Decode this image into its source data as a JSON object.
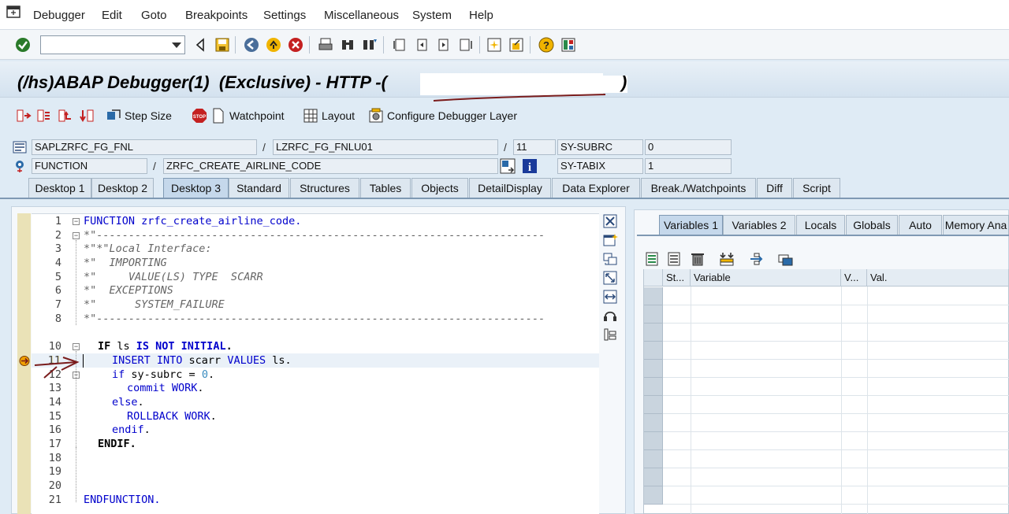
{
  "menubar": {
    "items": [
      "Debugger",
      "Edit",
      "Goto",
      "Breakpoints",
      "Settings",
      "Miscellaneous",
      "System",
      "Help"
    ]
  },
  "stdbar": {
    "command_value": "",
    "icons": [
      "enter-icon",
      "back-icon",
      "save-icon",
      "back-nav-icon",
      "exit-icon",
      "cancel-icon",
      "print-icon",
      "find-icon",
      "find-next-icon",
      "first-page-icon",
      "prev-page-icon",
      "next-page-icon",
      "last-page-icon",
      "new-session-icon",
      "shortcut-icon",
      "help-icon",
      "layout-icon"
    ]
  },
  "title": {
    "text": "(/hs)ABAP Debugger(1)  (Exclusive) - HTTP -(",
    "end": ")"
  },
  "app_toolbar": {
    "step_size": "Step Size",
    "watchpoint": "Watchpoint",
    "layout": "Layout",
    "configure": "Configure Debugger Layer"
  },
  "info": {
    "program": "SAPLZRFC_FG_FNL",
    "include": "LZRFC_FG_FNLU01",
    "line": "11",
    "sy_subrc_label": "SY-SUBRC",
    "sy_subrc_value": "0",
    "event_type": "FUNCTION",
    "event": "ZRFC_CREATE_AIRLINE_CODE",
    "sy_tabix_label": "SY-TABIX",
    "sy_tabix_value": "1",
    "sep": "/"
  },
  "tabs": [
    "Desktop 1",
    "Desktop 2",
    "Desktop 3",
    "Standard",
    "Structures",
    "Tables",
    "Objects",
    "DetailDisplay",
    "Data Explorer",
    "Break./Watchpoints",
    "Diff",
    "Script"
  ],
  "active_tab": "Desktop 3",
  "code": {
    "line_numbers": [
      "1",
      "2",
      "3",
      "4",
      "5",
      "6",
      "7",
      "8",
      "10",
      "11",
      "12",
      "13",
      "14",
      "15",
      "16",
      "17",
      "18",
      "19",
      "20",
      "21"
    ],
    "l1": "FUNCTION zrfc_create_airline_code.",
    "l2": "*\"----------------------------------------------------------------------",
    "l3": "*\"*\"Local Interface:",
    "l4": "*\"  IMPORTING",
    "l5": "*\"     VALUE(LS) TYPE  SCARR",
    "l6": "*\"  EXCEPTIONS",
    "l7": "*\"      SYSTEM_FAILURE",
    "l8": "*\"----------------------------------------------------------------------",
    "l10_kw1": "IF",
    "l10_id": " ls ",
    "l10_kw2": "IS NOT INITIAL",
    "l10_end": ".",
    "l11_kw1": "INSERT INTO",
    "l11_id": " scarr ",
    "l11_kw2": "VALUES",
    "l11_end": " ls.",
    "l12_kw": "if",
    "l12_id": " sy-subrc = ",
    "l12_num": "0",
    "l12_end": ".",
    "l13_kw": "commit WORK",
    "l13_end": ".",
    "l14_kw": "else",
    "l14_end": ".",
    "l15_kw": "ROLLBACK WORK",
    "l15_end": ".",
    "l16_kw": "endif",
    "l16_end": ".",
    "l17_kw": "ENDIF",
    "l17_end": ".",
    "l21_kw": "ENDFUNCTION",
    "l21_end": "."
  },
  "vars": {
    "tabs": [
      "Variables 1",
      "Variables 2",
      "Locals",
      "Globals",
      "Auto",
      "Memory Ana"
    ],
    "active": "Variables 1",
    "col_status": "St...",
    "col_variable": "Variable",
    "col_v": "V...",
    "col_val": "Val."
  },
  "colors": {
    "keyword": "#0000cc",
    "comment": "#666666",
    "annotation": "#7a1c1c"
  }
}
